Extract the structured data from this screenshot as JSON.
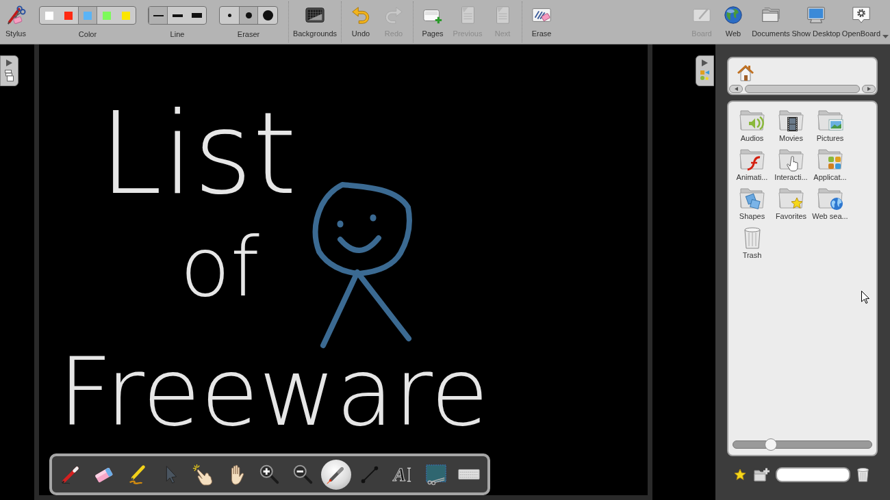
{
  "toolbar": {
    "stylus": {
      "label": "Stylus"
    },
    "color": {
      "label": "Color",
      "options": [
        {
          "color": "#ffffff",
          "selected": false
        },
        {
          "color": "#ff2a12",
          "selected": false
        },
        {
          "color": "#5ab4f6",
          "selected": true
        },
        {
          "color": "#7dfa5a",
          "selected": false
        },
        {
          "color": "#fbe600",
          "selected": false
        }
      ]
    },
    "line": {
      "label": "Line",
      "options": [
        {
          "kind": "thin",
          "selected": true
        },
        {
          "kind": "medium",
          "selected": false
        },
        {
          "kind": "thick",
          "selected": false
        }
      ]
    },
    "eraser": {
      "label": "Eraser",
      "options": [
        {
          "kind": "small",
          "selected": false
        },
        {
          "kind": "medium",
          "selected": true
        },
        {
          "kind": "large",
          "selected": false
        }
      ]
    },
    "action_groups": [
      {
        "buttons": [
          {
            "kind": "backgrounds",
            "label": "Backgrounds",
            "disabled": false
          }
        ]
      },
      {
        "buttons": [
          {
            "kind": "undo",
            "label": "Undo",
            "disabled": false
          },
          {
            "kind": "redo",
            "label": "Redo",
            "disabled": true
          }
        ]
      },
      {
        "buttons": [
          {
            "kind": "pages",
            "label": "Pages",
            "disabled": false
          },
          {
            "kind": "previous",
            "label": "Previous",
            "disabled": true
          },
          {
            "kind": "next",
            "label": "Next",
            "disabled": true
          }
        ]
      },
      {
        "buttons": [
          {
            "kind": "erase",
            "label": "Erase",
            "disabled": false
          }
        ]
      }
    ],
    "modes": [
      {
        "kind": "board",
        "label": "Board",
        "disabled": true
      },
      {
        "kind": "web",
        "label": "Web",
        "disabled": false
      },
      {
        "kind": "documents",
        "label": "Documents",
        "disabled": false
      },
      {
        "kind": "desktop",
        "label": "Show Desktop",
        "disabled": false
      },
      {
        "kind": "openboard",
        "label": "OpenBoard",
        "disabled": false
      }
    ]
  },
  "board": {
    "handwriting": [
      "List",
      "of",
      "Freeware"
    ]
  },
  "floating_toolbar": {
    "tools": [
      {
        "kind": "pen",
        "selected": false
      },
      {
        "kind": "eraser",
        "selected": false
      },
      {
        "kind": "marker",
        "selected": false
      },
      {
        "kind": "selector",
        "selected": false
      },
      {
        "kind": "interact",
        "selected": false
      },
      {
        "kind": "hand",
        "selected": false
      },
      {
        "kind": "zoom_in",
        "selected": false
      },
      {
        "kind": "zoom_out",
        "selected": false
      },
      {
        "kind": "laser",
        "selected": true
      },
      {
        "kind": "line",
        "selected": false
      },
      {
        "kind": "text",
        "glyph": "A",
        "selected": false
      },
      {
        "kind": "capture",
        "selected": false
      },
      {
        "kind": "keyboard",
        "selected": false
      }
    ]
  },
  "library": {
    "items": [
      {
        "kind": "audios",
        "label": "Audios"
      },
      {
        "kind": "movies",
        "label": "Movies"
      },
      {
        "kind": "pictures",
        "label": "Pictures"
      },
      {
        "kind": "animations",
        "label": "Animati..."
      },
      {
        "kind": "interactivities",
        "label": "Interacti..."
      },
      {
        "kind": "applications",
        "label": "Applicat..."
      },
      {
        "kind": "shapes",
        "label": "Shapes"
      },
      {
        "kind": "favorites",
        "label": "Favorites"
      },
      {
        "kind": "web_search",
        "label": "Web sea..."
      },
      {
        "kind": "trash",
        "label": "Trash"
      }
    ],
    "slider": {
      "level": 0.25
    }
  }
}
